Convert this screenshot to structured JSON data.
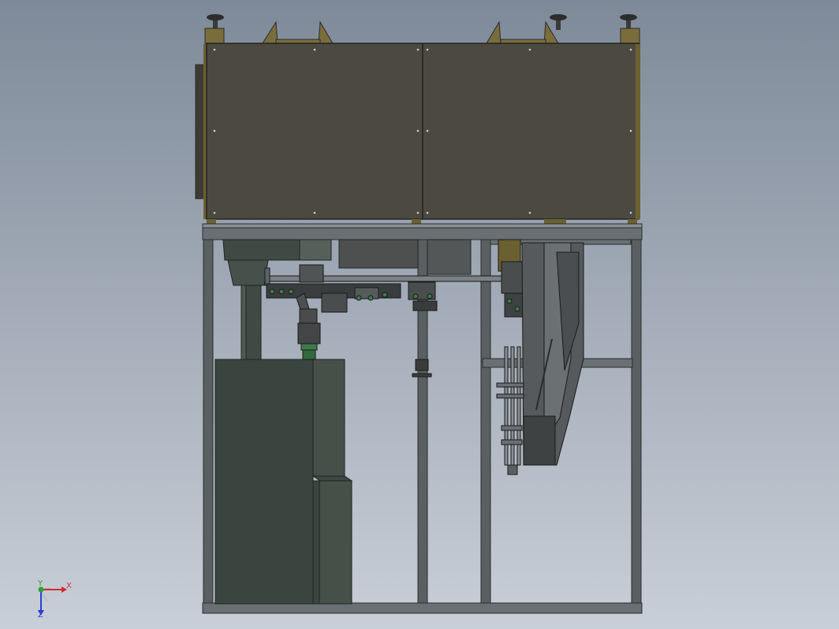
{
  "viewport": {
    "background_top": "#7e8a99",
    "background_bottom": "#c9cfd8"
  },
  "colors": {
    "enclosure": "#4c4a40",
    "enclosure_edge": "#6b6030",
    "bracket": "#7a6d3c",
    "frame": "#505558",
    "frame_light": "#7b8084",
    "cabinet": "#3a4540",
    "cabinet_shade": "#455049",
    "green_part": "#3c7a4a",
    "chute": "#565a5c",
    "rod": "#8a8f94"
  },
  "triad": {
    "x_label": "X",
    "y_label": "Y",
    "z_label": "Z",
    "x_color": "#d22a2a",
    "y_color": "#2ea12e",
    "z_color": "#2b3fd8"
  }
}
